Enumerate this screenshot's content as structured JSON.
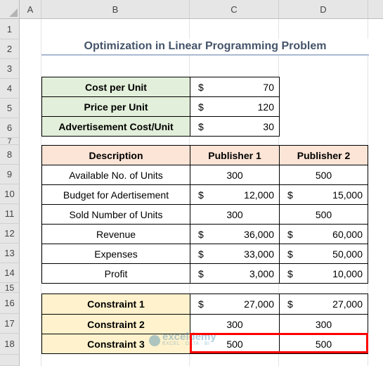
{
  "sheet": {
    "columns": [
      "A",
      "B",
      "C",
      "D"
    ],
    "rows": [
      "1",
      "2",
      "3",
      "4",
      "5",
      "6",
      "7",
      "8",
      "9",
      "10",
      "11",
      "12",
      "13",
      "14",
      "15",
      "16",
      "17",
      "18"
    ]
  },
  "title": "Optimization in Linear Programming Problem",
  "inputs": [
    {
      "label": "Cost per Unit",
      "currency": "$",
      "value": "70"
    },
    {
      "label": "Price per Unit",
      "currency": "$",
      "value": "120"
    },
    {
      "label": "Advertisement Cost/Unit",
      "currency": "$",
      "value": "30"
    }
  ],
  "table": {
    "headers": [
      "Description",
      "Publisher 1",
      "Publisher 2"
    ],
    "rows": [
      {
        "label": "Available No. of Units",
        "c1": "300",
        "c2": "500",
        "cur1": "",
        "cur2": ""
      },
      {
        "label": "Budget for Adertisement",
        "c1": "12,000",
        "c2": "15,000",
        "cur1": "$",
        "cur2": "$"
      },
      {
        "label": "Sold Number of Units",
        "c1": "300",
        "c2": "500",
        "cur1": "",
        "cur2": ""
      },
      {
        "label": "Revenue",
        "c1": "36,000",
        "c2": "60,000",
        "cur1": "$",
        "cur2": "$"
      },
      {
        "label": "Expenses",
        "c1": "33,000",
        "c2": "50,000",
        "cur1": "$",
        "cur2": "$"
      },
      {
        "label": "Profit",
        "c1": "3,000",
        "c2": "10,000",
        "cur1": "$",
        "cur2": "$"
      }
    ]
  },
  "constraints": [
    {
      "label": "Constraint 1",
      "c1": "27,000",
      "c2": "27,000",
      "cur1": "$",
      "cur2": "$"
    },
    {
      "label": "Constraint 2",
      "c1": "300",
      "c2": "300",
      "cur1": "",
      "cur2": ""
    },
    {
      "label": "Constraint 3",
      "c1": "500",
      "c2": "500",
      "cur1": "",
      "cur2": ""
    }
  ],
  "watermark": {
    "name": "exceldemy",
    "tagline": "EXCEL · DATA · BI"
  },
  "colors": {
    "green": "#e2efda",
    "peach": "#fce4d6",
    "yellow": "#fff2cc",
    "highlight": "#ff0000",
    "title": "#44546a"
  }
}
